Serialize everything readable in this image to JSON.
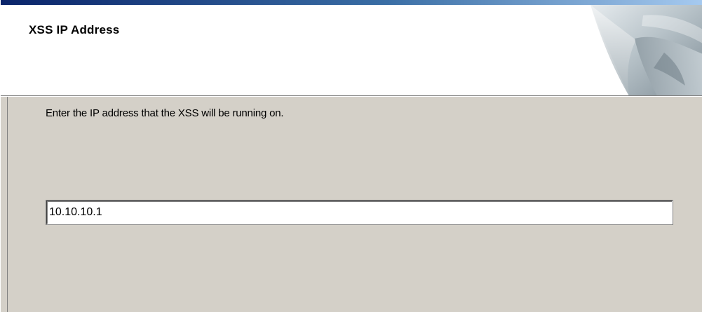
{
  "dialog": {
    "header_title": "XSS IP Address",
    "instruction": "Enter the IP address that the XSS will be running on.",
    "ip_field": {
      "value": "10.10.10.1",
      "placeholder": ""
    },
    "header_graphic_icon": "page-curl-icon"
  },
  "colors": {
    "dialog_background": "#d4d0c8",
    "header_background": "#ffffff",
    "title_bar_start": "#0a246a",
    "title_bar_end": "#a6caf0"
  }
}
